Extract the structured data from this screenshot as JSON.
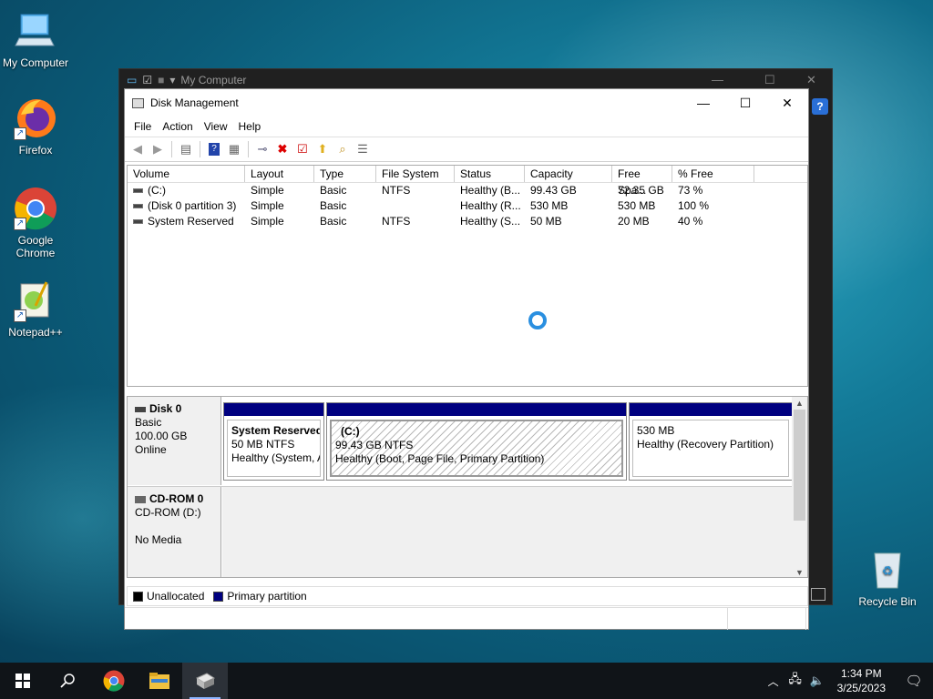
{
  "desktop": {
    "icons": [
      {
        "label": "My Computer"
      },
      {
        "label": "Firefox"
      },
      {
        "label": "Google Chrome"
      },
      {
        "label": "Notepad++"
      },
      {
        "label": "Recycle Bin"
      }
    ]
  },
  "back_window": {
    "title": "My Computer"
  },
  "window": {
    "title": "Disk Management",
    "menu": [
      "File",
      "Action",
      "View",
      "Help"
    ]
  },
  "list": {
    "columns": [
      "Volume",
      "Layout",
      "Type",
      "File System",
      "Status",
      "Capacity",
      "Free Spa...",
      "% Free"
    ],
    "rows": [
      {
        "volume": "(C:)",
        "layout": "Simple",
        "type": "Basic",
        "fs": "NTFS",
        "status": "Healthy (B...",
        "capacity": "99.43 GB",
        "free": "72.35 GB",
        "pct": "73 %"
      },
      {
        "volume": "(Disk 0 partition 3)",
        "layout": "Simple",
        "type": "Basic",
        "fs": "",
        "status": "Healthy (R...",
        "capacity": "530 MB",
        "free": "530 MB",
        "pct": "100 %"
      },
      {
        "volume": "System Reserved",
        "layout": "Simple",
        "type": "Basic",
        "fs": "NTFS",
        "status": "Healthy (S...",
        "capacity": "50 MB",
        "free": "20 MB",
        "pct": "40 %"
      }
    ]
  },
  "disks": [
    {
      "name": "Disk 0",
      "kind": "Basic",
      "size": "100.00 GB",
      "state": "Online",
      "partitions": [
        {
          "name": "System Reserved",
          "detail": "50 MB NTFS",
          "status": "Healthy (System, A"
        },
        {
          "name": "(C:)",
          "detail": "99.43 GB NTFS",
          "status": "Healthy (Boot, Page File, Primary Partition)"
        },
        {
          "name": "",
          "detail": "530 MB",
          "status": "Healthy (Recovery Partition)"
        }
      ]
    },
    {
      "name": "CD-ROM 0",
      "kind": "CD-ROM (D:)",
      "size": "",
      "state": "No Media"
    }
  ],
  "legend": {
    "unallocated": "Unallocated",
    "primary": "Primary partition",
    "unallocated_color": "#000000",
    "primary_color": "#000080"
  },
  "taskbar": {
    "time": "1:34 PM",
    "date": "3/25/2023"
  }
}
